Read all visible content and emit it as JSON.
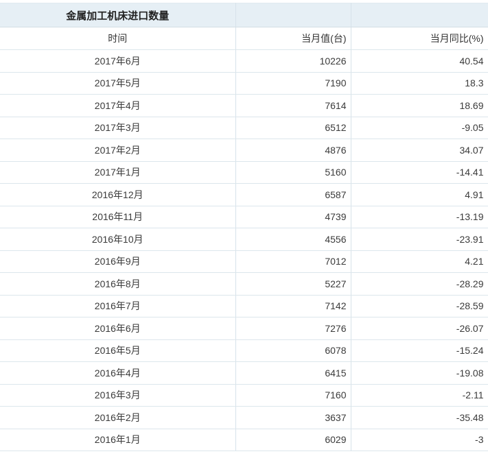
{
  "chart_data": {
    "type": "table",
    "title": "金属加工机床进口数量",
    "columns": [
      "时间",
      "当月值(台)",
      "当月同比(%)"
    ],
    "rows": [
      [
        "2017年6月",
        "10226",
        "40.54"
      ],
      [
        "2017年5月",
        "7190",
        "18.3"
      ],
      [
        "2017年4月",
        "7614",
        "18.69"
      ],
      [
        "2017年3月",
        "6512",
        "-9.05"
      ],
      [
        "2017年2月",
        "4876",
        "34.07"
      ],
      [
        "2017年1月",
        "5160",
        "-14.41"
      ],
      [
        "2016年12月",
        "6587",
        "4.91"
      ],
      [
        "2016年11月",
        "4739",
        "-13.19"
      ],
      [
        "2016年10月",
        "4556",
        "-23.91"
      ],
      [
        "2016年9月",
        "7012",
        "4.21"
      ],
      [
        "2016年8月",
        "5227",
        "-28.29"
      ],
      [
        "2016年7月",
        "7142",
        "-28.59"
      ],
      [
        "2016年6月",
        "7276",
        "-26.07"
      ],
      [
        "2016年5月",
        "6078",
        "-15.24"
      ],
      [
        "2016年4月",
        "6415",
        "-19.08"
      ],
      [
        "2016年3月",
        "7160",
        "-2.11"
      ],
      [
        "2016年2月",
        "3637",
        "-35.48"
      ],
      [
        "2016年1月",
        "6029",
        "-3"
      ]
    ],
    "layout": {
      "title_row_background": "#e6eff5",
      "border_color": "#dce6ec",
      "text_color": "#3a3a3a",
      "value_columns_alignment": "right",
      "time_column_alignment": "center"
    }
  }
}
